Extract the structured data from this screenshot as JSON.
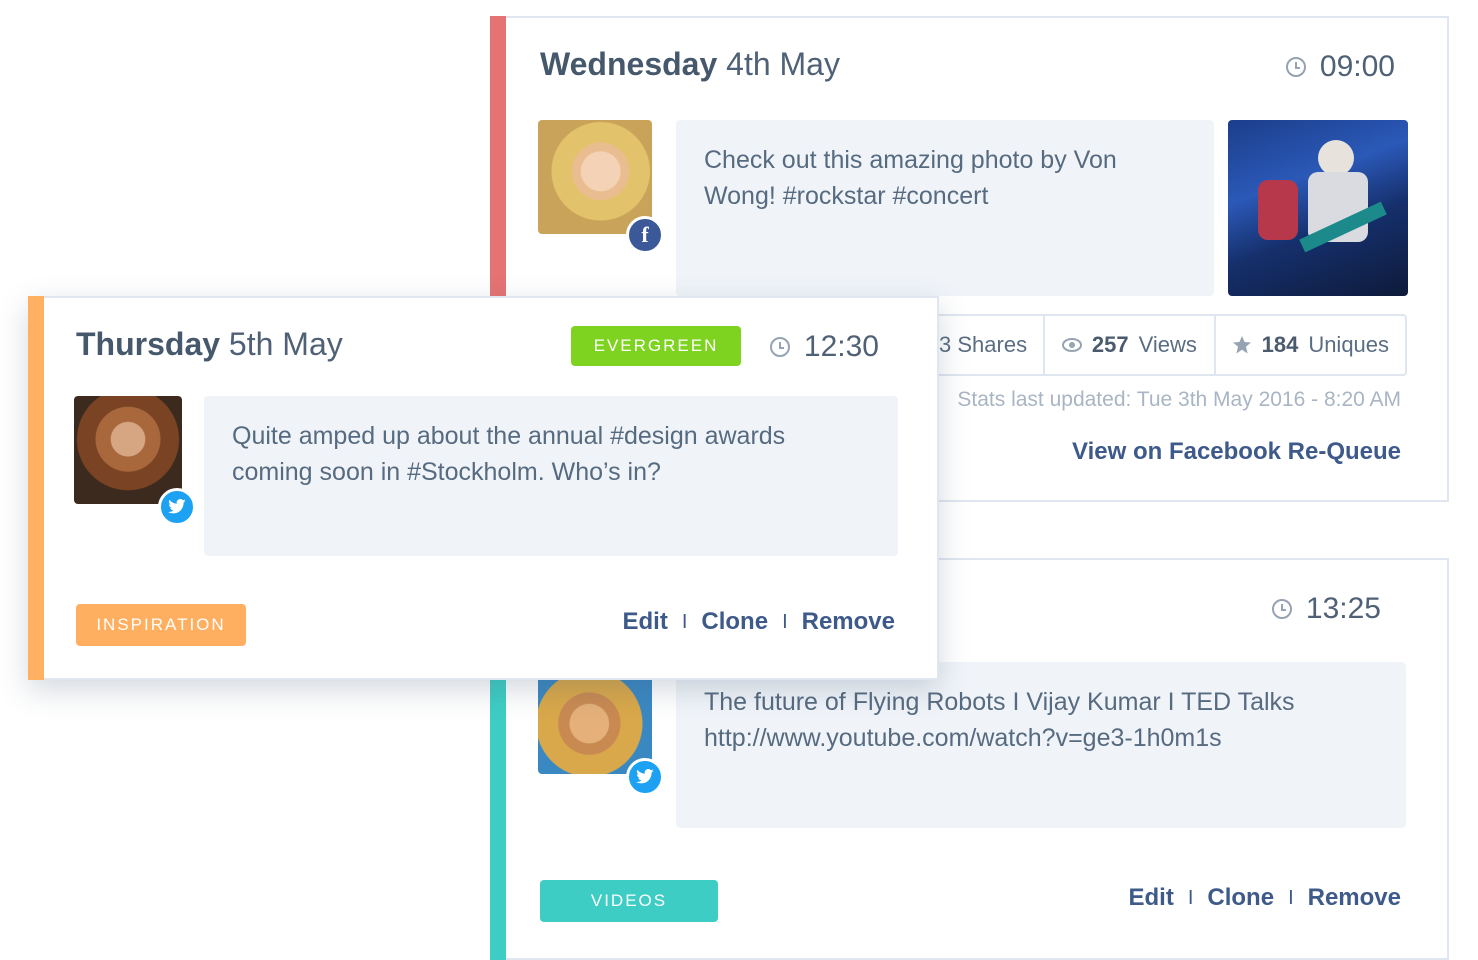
{
  "colors": {
    "red_stripe": "#e57373",
    "orange_stripe": "#ffb061",
    "teal_stripe": "#3ecdc4",
    "evergreen": "#7ed321",
    "inspiration": "#ffaf5f",
    "videos": "#3ecdc4",
    "link": "#3e5a8a"
  },
  "card_wednesday": {
    "date_bold": "Wednesday",
    "date_rest": "4th May",
    "time": "09:00",
    "network": "facebook",
    "badge_label": "f",
    "message": "Check out this amazing photo by Von Wong! #rockstar #concert",
    "stats": {
      "shares": "3 Shares",
      "views_num": "257",
      "views_label": "Views",
      "uniques_num": "184",
      "uniques_label": "Uniques"
    },
    "updated": "Stats last updated: Tue 3th May 2016 - 8:20 AM",
    "view_link": "View on Facebook Re-Queue"
  },
  "card_thursday": {
    "date_bold": "Thursday",
    "date_rest": "5th May",
    "time": "12:30",
    "network": "twitter",
    "badge_tag": "EVERGREEN",
    "message": "Quite amped up about the annual #design awards coming soon in #Stockholm. Who’s in?",
    "category": "INSPIRATION",
    "actions": {
      "edit": "Edit",
      "clone": "Clone",
      "remove": "Remove",
      "separator": "I"
    }
  },
  "card_videos": {
    "time": "13:25",
    "network": "twitter",
    "message": "The future of Flying Robots I Vijay Kumar I TED Talks http://www.youtube.com/watch?v=ge3-1h0m1s",
    "category": "VIDEOS",
    "actions": {
      "edit": "Edit",
      "clone": "Clone",
      "remove": "Remove",
      "separator": "I"
    }
  }
}
